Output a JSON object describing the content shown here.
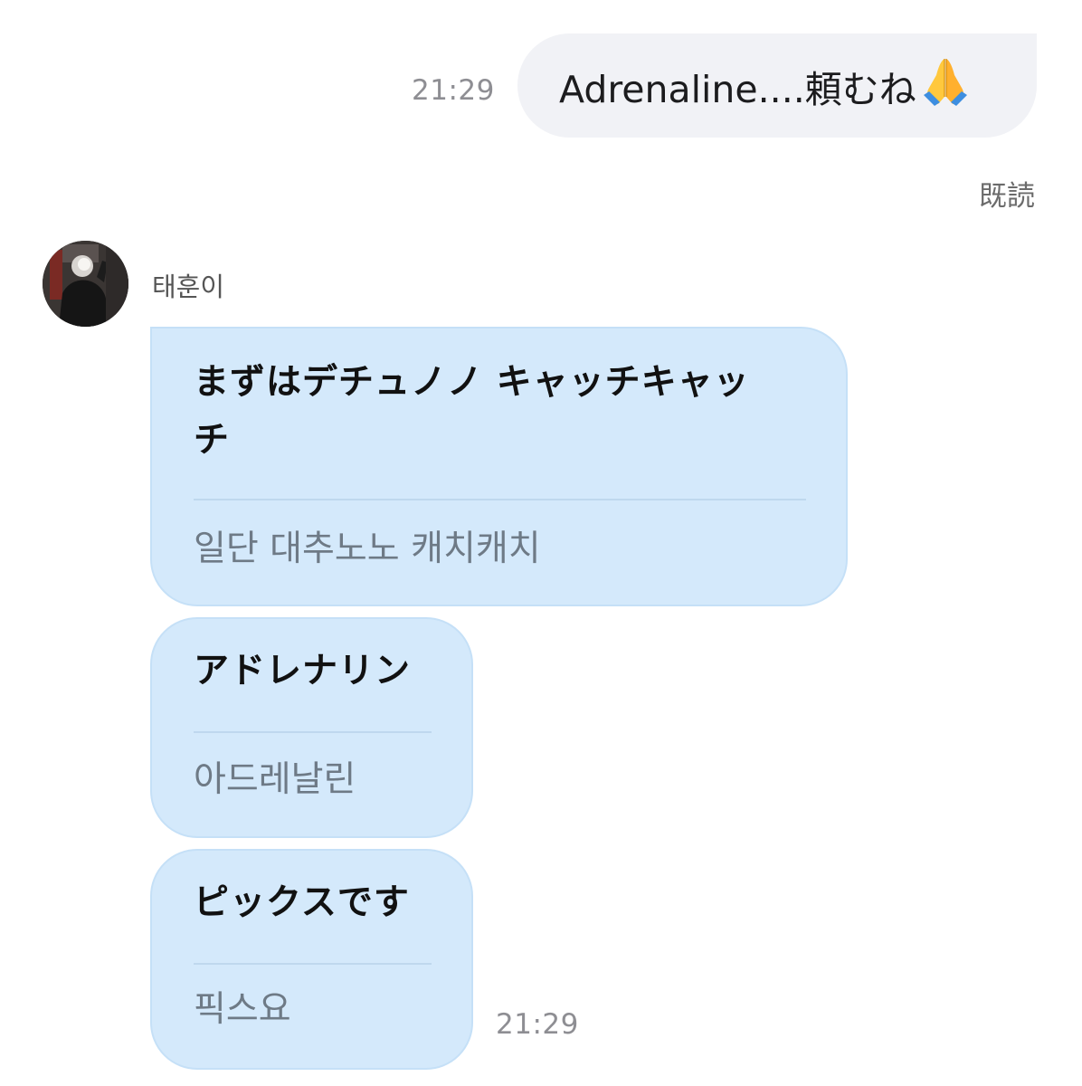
{
  "outgoing": {
    "time": "21:29",
    "text": "Adrenaline....頼むね",
    "emoji": "folded-hands-icon",
    "read_status": "既読"
  },
  "incoming": {
    "sender_name": "태훈이",
    "time": "21:29",
    "messages": [
      {
        "original_line1": "まずはデチュノノ キャッチキャッ",
        "original_line2": "チ",
        "translation": "일단 대추노노 캐치캐치"
      },
      {
        "original_line1": "アドレナリン",
        "translation": "아드레날린"
      },
      {
        "original_line1": "ピックスです",
        "translation": "픽스요"
      }
    ]
  },
  "colors": {
    "outgoing_bubble": "#f1f2f6",
    "incoming_bubble": "#d4e9fb",
    "timestamp": "#8e8e93"
  }
}
